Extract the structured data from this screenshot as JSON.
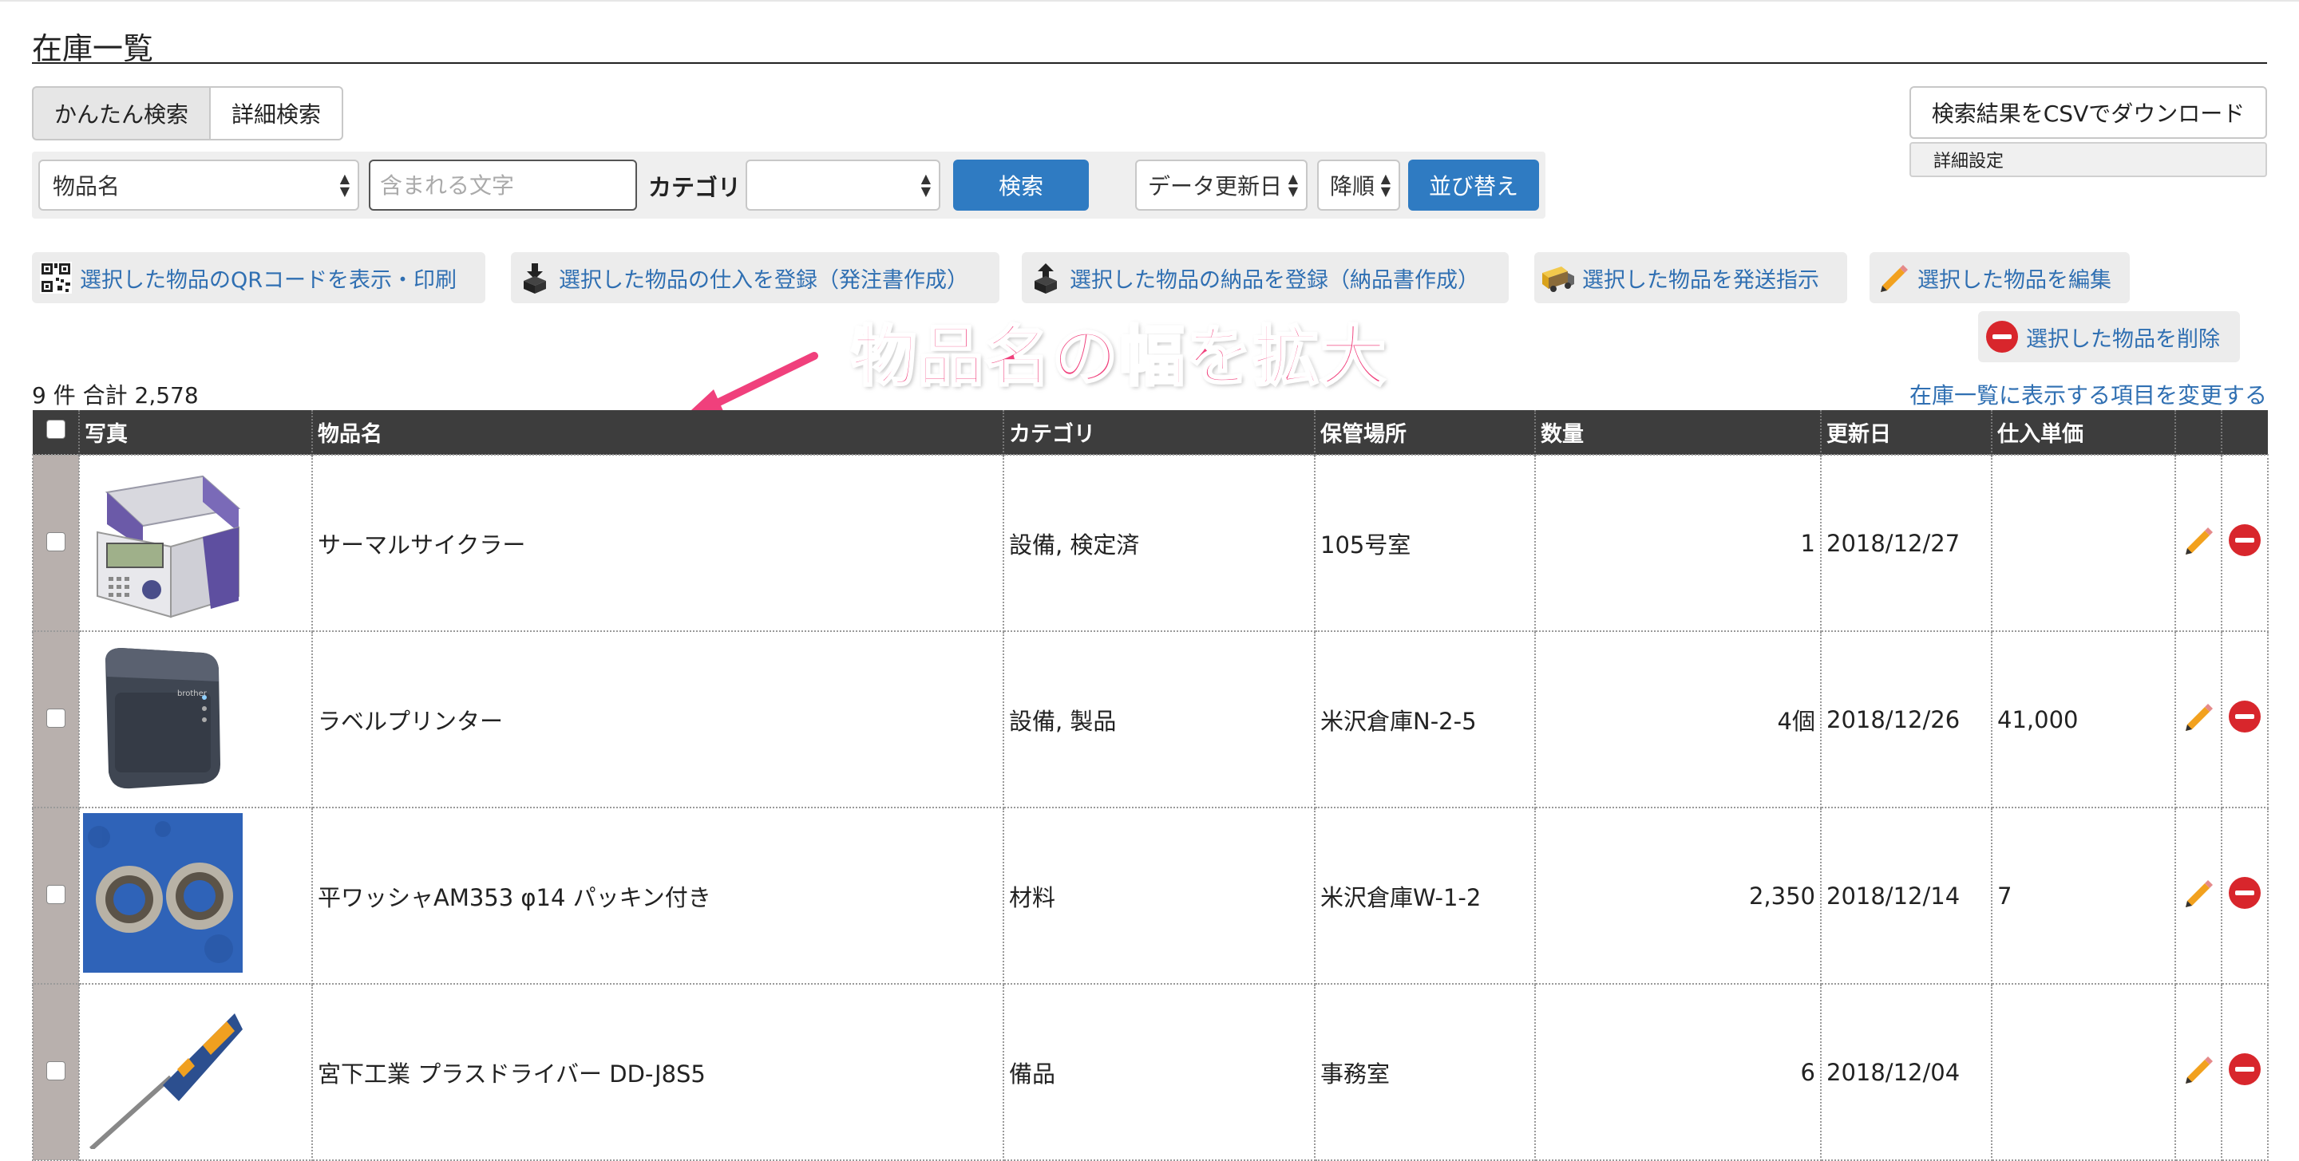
{
  "page": {
    "title": "在庫一覧"
  },
  "search_tabs": {
    "simple": "かんたん検索",
    "detail": "詳細検索"
  },
  "search": {
    "field_select": "物品名",
    "text_placeholder": "含まれる文字",
    "category_label": "カテゴリ",
    "category_value": "",
    "search_button": "検索",
    "sort_field": "データ更新日",
    "sort_order": "降順",
    "sort_button": "並び替え"
  },
  "top_right": {
    "csv_button": "検索結果をCSVでダウンロード",
    "detail_settings": "詳細設定"
  },
  "actions": {
    "qr": "選択した物品のQRコードを表示・印刷",
    "purchase": "選択した物品の仕入を登録（発注書作成）",
    "delivery": "選択した物品の納品を登録（納品書作成）",
    "ship": "選択した物品を発送指示",
    "edit": "選択した物品を編集",
    "delete": "選択した物品を削除"
  },
  "annotation": {
    "text": "物品名の幅を拡大"
  },
  "summary": {
    "count": "9 件 合計 2,578",
    "change_columns": "在庫一覧に表示する項目を変更する"
  },
  "table": {
    "headers": {
      "photo": "写真",
      "name": "物品名",
      "category": "カテゴリ",
      "location": "保管場所",
      "qty": "数量",
      "updated": "更新日",
      "unit_price": "仕入単価"
    },
    "rows": [
      {
        "photo": "thermal-cycler",
        "name": "サーマルサイクラー",
        "category": "設備, 検定済",
        "location": "105号室",
        "qty": "1",
        "updated": "2018/12/27",
        "unit_price": ""
      },
      {
        "photo": "label-printer",
        "name": "ラベルプリンター",
        "category": "設備, 製品",
        "location": "米沢倉庫N-2-5",
        "qty": "4個",
        "updated": "2018/12/26",
        "unit_price": "41,000"
      },
      {
        "photo": "washers",
        "name": "平ワッシャAM353 φ14 パッキン付き",
        "category": "材料",
        "location": "米沢倉庫W-1-2",
        "qty": "2,350",
        "updated": "2018/12/14",
        "unit_price": "7"
      },
      {
        "photo": "screwdriver",
        "name": "宮下工業 プラスドライバー DD-J8S5",
        "category": "備品",
        "location": "事務室",
        "qty": "6",
        "updated": "2018/12/04",
        "unit_price": ""
      }
    ]
  },
  "colors": {
    "accent": "#2f7bc2",
    "link": "#2f6fb2",
    "annotation": "#f0407c",
    "header_bg": "#3d3d3d",
    "delete": "#d8262c"
  }
}
